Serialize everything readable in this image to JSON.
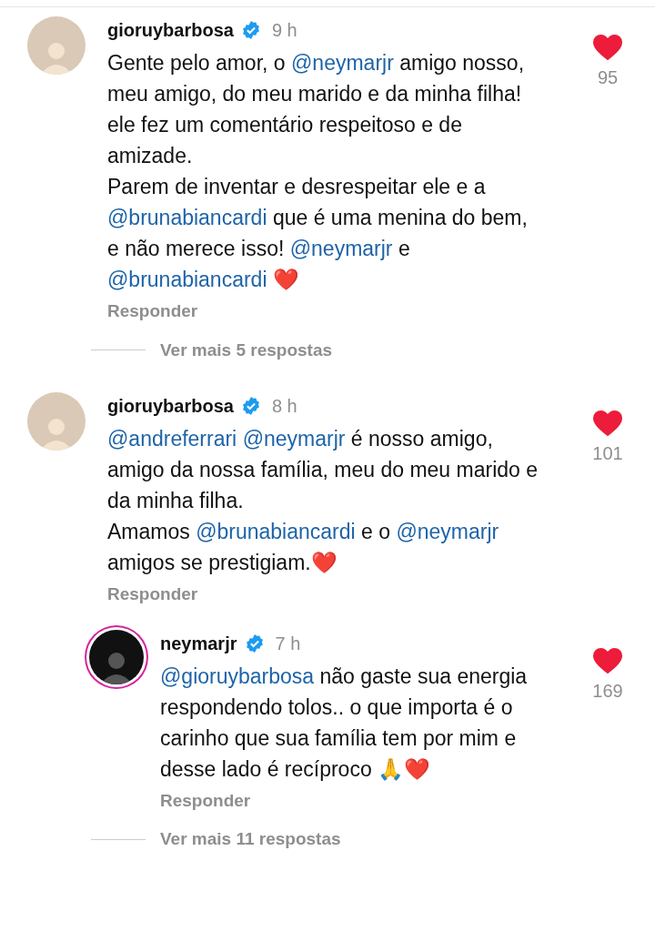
{
  "comments": [
    {
      "username": "gioruybarbosa",
      "verified": true,
      "time": "9 h",
      "story_ring": false,
      "liked": true,
      "likes": "95",
      "reply_label": "Responder",
      "text": [
        {
          "kind": "text",
          "text": "Gente pelo amor, o "
        },
        {
          "kind": "mention",
          "text": "@neymarjr"
        },
        {
          "kind": "text",
          "text": "  amigo nosso, meu amigo, do meu marido e da minha filha!\nele fez um comentário respeitoso e de amizade.\nParem de inventar e desrespeitar ele e a "
        },
        {
          "kind": "mention",
          "text": "@brunabiancardi"
        },
        {
          "kind": "text",
          "text": " que é uma menina do bem, e não merece isso! "
        },
        {
          "kind": "mention",
          "text": "@neymarjr"
        },
        {
          "kind": "text",
          "text": " e "
        },
        {
          "kind": "mention",
          "text": "@brunabiancardi"
        },
        {
          "kind": "text",
          "text": " ❤️"
        }
      ],
      "view_more": "Ver mais 5 respostas"
    },
    {
      "username": "gioruybarbosa",
      "verified": true,
      "time": "8 h",
      "story_ring": false,
      "liked": true,
      "likes": "101",
      "reply_label": "Responder",
      "text": [
        {
          "kind": "mention",
          "text": "@andreferrari"
        },
        {
          "kind": "mention",
          "text": "@neymarjr"
        },
        {
          "kind": "text",
          "text": " é nosso amigo, amigo da nossa família, meu do meu marido e da minha filha.\nAmamos "
        },
        {
          "kind": "mention",
          "text": "@brunabiancardi"
        },
        {
          "kind": "text",
          "text": " e o "
        },
        {
          "kind": "mention",
          "text": "@neymarjr"
        },
        {
          "kind": "text",
          "text": "\namigos se prestigiam.❤️"
        }
      ],
      "replies": [
        {
          "username": "neymarjr",
          "verified": true,
          "time": "7 h",
          "story_ring": true,
          "liked": true,
          "likes": "169",
          "reply_label": "Responder",
          "text": [
            {
              "kind": "mention",
              "text": "@gioruybarbosa"
            },
            {
              "kind": "text",
              "text": " não gaste sua energia respondendo tolos.. o que importa é o carinho que sua família tem por mim e desse lado é recíproco 🙏❤️"
            }
          ]
        }
      ],
      "view_more": "Ver mais 11 respostas"
    }
  ]
}
